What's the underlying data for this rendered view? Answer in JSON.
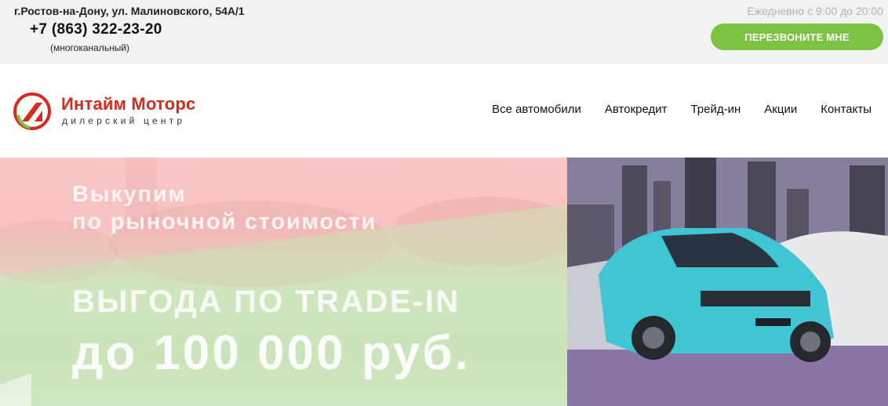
{
  "topbar": {
    "address": "г.Ростов-на-Дону, ул. Малиновского, 54А/1",
    "phone": "+7 (863) 322-23-20",
    "phone_note": "(многоканальный)",
    "hours": "Ежедневно с 9:00 до 20:00",
    "callback_label": "ПЕРЕЗВОНИТЕ МНЕ"
  },
  "header": {
    "logo_title": "Интайм Моторс",
    "logo_subtitle": "дилерский центр",
    "nav": [
      "Все автомобили",
      "Автокредит",
      "Трейд-ин",
      "Акции",
      "Контакты"
    ]
  },
  "banner": {
    "line1": "Выкупим",
    "line2": "по рыночной стоимости",
    "line3": "ВЫГОДА ПО TRADE-IN",
    "line4": "до 100 000 руб."
  },
  "colors": {
    "brand_red": "#d52b1e",
    "callback_green": "#7dc243",
    "topbar_bg": "#f2f2f2"
  },
  "icons": {
    "logo_mark": "intime-motors-logo"
  }
}
